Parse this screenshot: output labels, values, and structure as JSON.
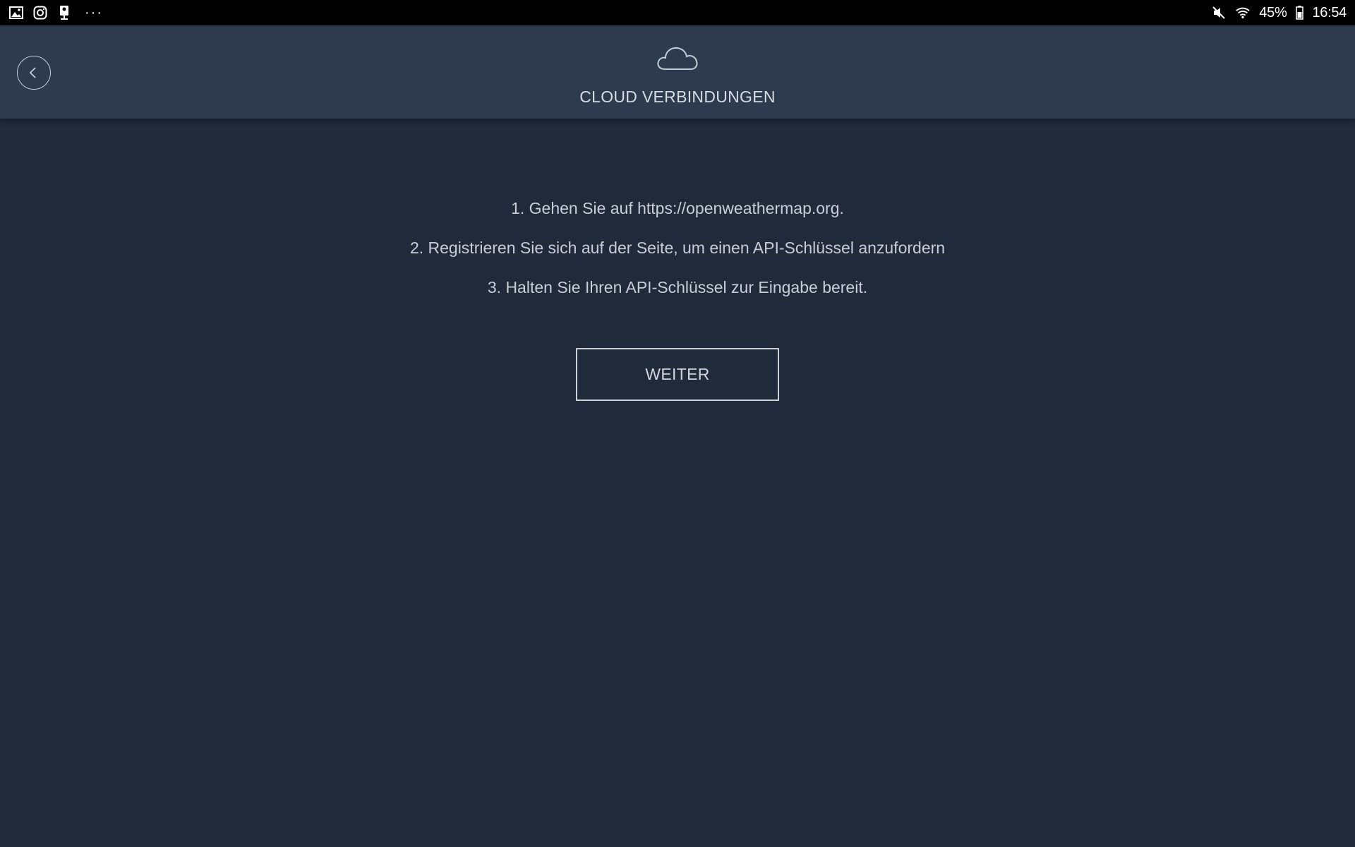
{
  "status_bar": {
    "left_icons": [
      "gallery-icon",
      "instagram-icon",
      "doorbell-camera-icon"
    ],
    "overflow_label": "···",
    "battery_percent": "45%",
    "time": "16:54",
    "right_icons": [
      "mute-icon",
      "wifi-icon",
      "battery-icon"
    ]
  },
  "header": {
    "title": "CLOUD VERBINDUNGEN",
    "icon": "cloud-icon",
    "back_icon": "back-arrow-icon"
  },
  "instructions": [
    "1. Gehen Sie auf https://openweathermap.org.",
    "2. Registrieren Sie sich auf der Seite, um einen API-Schlüssel anzufordern",
    "3. Halten Sie Ihren API-Schlüssel zur Eingabe bereit."
  ],
  "next_button": {
    "label": "WEITER"
  },
  "colors": {
    "background": "#212a3a",
    "header_background": "#2e3a4d",
    "status_bar": "#000000",
    "text": "#c8cdd6"
  }
}
